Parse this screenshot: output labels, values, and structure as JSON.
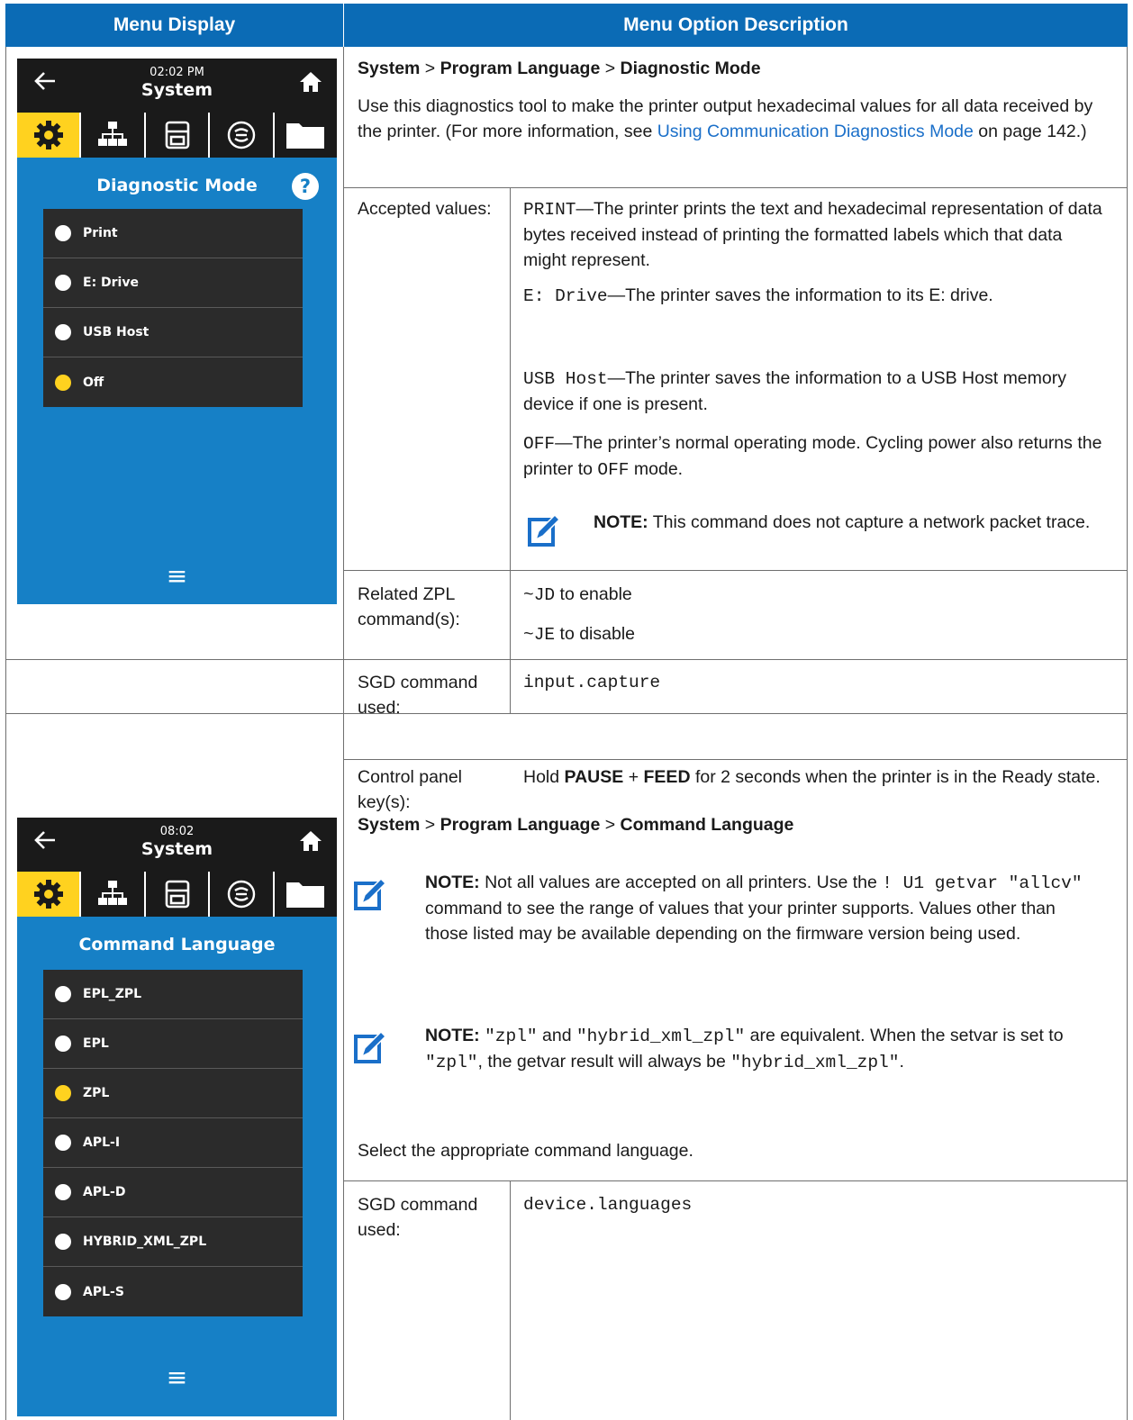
{
  "header": {
    "left": "Menu Display",
    "right": "Menu Option Description"
  },
  "section1": {
    "screen": {
      "time": "02:02 PM",
      "title": "System",
      "menu_title": "Diagnostic Mode",
      "help": "?",
      "options": [
        {
          "label": "Print",
          "selected": false
        },
        {
          "label": "E: Drive",
          "selected": false
        },
        {
          "label": "USB Host",
          "selected": false
        },
        {
          "label": "Off",
          "selected": true
        }
      ],
      "menu_icon": "≡"
    },
    "path": {
      "a": "System",
      "sep1": " > ",
      "b": "Program Language",
      "sep2": " > ",
      "c": "Diagnostic Mode"
    },
    "desc_1": "Use this diagnostics tool to make the printer output hexadecimal values for all data received by the printer. (For more information, see ",
    "desc_link": "Using Communication Diagnostics Mode",
    "desc_2": " on page 142.)",
    "accepted_label": "Accepted values:",
    "v1_code": "PRINT",
    "v1_text": "—The printer prints the text and hexadecimal representation of data bytes received instead of printing the formatted labels which that data might represent.",
    "v2_code": "E: Drive",
    "v2_text": "—The printer saves the information to its E: drive.",
    "v3_code": "USB Host",
    "v3_text": "—The printer saves the information to a USB Host memory device if one is present.",
    "v4_code": "OFF",
    "v4_text": "—The printer’s normal operating mode. Cycling power also returns the printer to ",
    "v4_code2": "OFF",
    "v4_tail": " mode.",
    "note_label": "NOTE:",
    "note_text": " This command does not capture a network packet trace.",
    "zpl_label": "Related ZPL command(s):",
    "zpl1_code": "~JD",
    "zpl1_text": " to enable",
    "zpl2_code": "~JE",
    "zpl2_text": " to disable",
    "sgd_label": "SGD command used:",
    "sgd_value": "input.capture",
    "panel_label": "Control panel key(s):",
    "panel_1": "Hold ",
    "panel_pause": "PAUSE",
    "panel_plus": " + ",
    "panel_feed": "FEED",
    "panel_2": " for 2 seconds when the printer is in the Ready state."
  },
  "section2": {
    "screen": {
      "time": "08:02",
      "title": "System",
      "menu_title": "Command Language",
      "options": [
        {
          "label": "EPL_ZPL",
          "selected": false
        },
        {
          "label": "EPL",
          "selected": false
        },
        {
          "label": "ZPL",
          "selected": true
        },
        {
          "label": "APL-I",
          "selected": false
        },
        {
          "label": "APL-D",
          "selected": false
        },
        {
          "label": "HYBRID_XML_ZPL",
          "selected": false
        },
        {
          "label": "APL-S",
          "selected": false
        }
      ],
      "menu_icon": "≡"
    },
    "path": {
      "a": "System",
      "sep1": " > ",
      "b": "Program Language",
      "sep2": " > ",
      "c": "Command Language"
    },
    "note1_label": "NOTE:",
    "note1_a": " Not all values are accepted on all printers. Use the ",
    "note1_code": "! U1 getvar \"allcv\"",
    "note1_b": " command to see the range of values that your printer supports. Values other than those listed may be available depending on the firmware version being used.",
    "note2_label": "NOTE:",
    "note2_code1": "\"zpl\"",
    "note2_a": " and ",
    "note2_code2": "\"hybrid_xml_zpl\"",
    "note2_b": " are equivalent. When the setvar is set to ",
    "note2_code3": "\"zpl\"",
    "note2_c": ", the getvar result will always be ",
    "note2_code4": "\"hybrid_xml_zpl\"",
    "note2_d": ".",
    "select_text": "Select the appropriate command language.",
    "sgd_label": "SGD command used:",
    "sgd_value": "device.languages"
  }
}
